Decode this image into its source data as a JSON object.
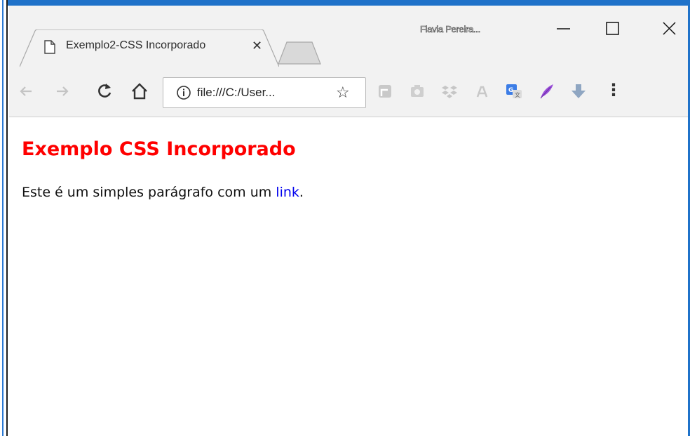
{
  "window": {
    "profile_name": "Flavia Pereira...",
    "min_glyph": "—",
    "max_glyph": "☐",
    "close_glyph": "✕"
  },
  "tab": {
    "title": "Exemplo2-CSS Incorporado",
    "favicon": "page-icon",
    "close_glyph": "✕"
  },
  "toolbar": {
    "back_icon": "arrow-left-icon",
    "forward_icon": "arrow-right-icon",
    "reload_icon": "reload-icon",
    "home_icon": "home-icon",
    "address": "file:///C:/User...",
    "bookmark_icon": "star-icon",
    "extensions": [
      "extension-icon",
      "camera-icon",
      "dropbox-icon",
      "ext-icon",
      "translate-icon",
      "feather-icon",
      "download-arrow-icon"
    ],
    "menu_glyph": "⋮"
  },
  "page": {
    "heading": "Exemplo CSS Incorporado",
    "paragraph_before": "Este é um simples parágrafo com um ",
    "link_text": "link",
    "paragraph_after": ".",
    "heading_color": "#ff0000",
    "link_color": "#0000ee"
  }
}
